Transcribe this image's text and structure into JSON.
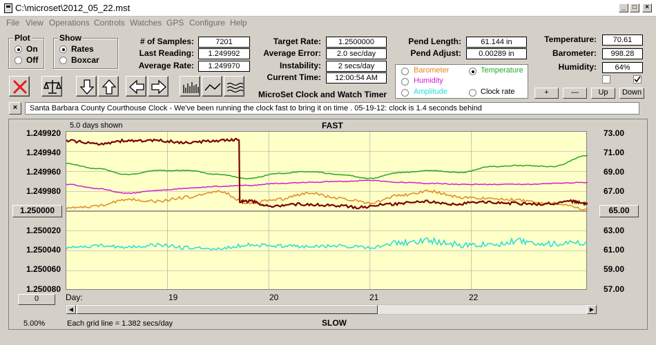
{
  "window": {
    "title": "C:\\microset\\2012_05_22.mst"
  },
  "menu": [
    "File",
    "View",
    "Operations",
    "Controls",
    "Watches",
    "GPS",
    "Configure",
    "Help"
  ],
  "plot_group": {
    "label": "Plot",
    "on": "On",
    "off": "Off"
  },
  "show_group": {
    "label": "Show",
    "rates": "Rates",
    "boxcar": "Boxcar"
  },
  "stats": {
    "samples_label": "# of Samples:",
    "samples": "7201",
    "last_reading_label": "Last Reading:",
    "last_reading": "1.249992",
    "average_rate_label": "Average Rate:",
    "average_rate": "1.249970",
    "target_rate_label": "Target Rate:",
    "target_rate": "1.2500000",
    "average_error_label": "Average Error:",
    "average_error": "2.0 sec/day",
    "instability_label": "Instability:",
    "instability": "2 secs/day",
    "current_time_label": "Current Time:",
    "current_time": "12:00:54 AM",
    "pend_length_label": "Pend Length:",
    "pend_length": "61.144 in",
    "pend_adjust_label": "Pend Adjust:",
    "pend_adjust": "0.00289 in",
    "temperature_label": "Temperature:",
    "temperature": "70.61",
    "barometer_label": "Barometer:",
    "barometer": "998.28",
    "humidity_label": "Humidity:",
    "humidity": "64%"
  },
  "app_name": "MicroSet Clock and Watch Timer",
  "right_axis_select": {
    "barometer": "Barometer",
    "temperature": "Temperature",
    "humidity": "Humidity",
    "amplitude": "Amplitude",
    "clock_rate": "Clock rate"
  },
  "axis_buttons": {
    "plus": "+",
    "minus": "—",
    "up": "Up",
    "down": "Down"
  },
  "notes": "Santa Barbara County Courthouse Clock - We've been running the clock fast to bring it on time .   05-19-12: clock is 1.4 seconds behind",
  "graph": {
    "days_shown": "5.0 days shown",
    "fast": "FAST",
    "slow": "SLOW",
    "grid_note": "Each grid line = 1.382 secs/day",
    "percent": "5.00%",
    "left_center_btn": "1.250000",
    "right_center_btn": "65.00",
    "zero_btn": "0",
    "day_label": "Day:"
  },
  "colors": {
    "rate": "#7a0000",
    "temperature": "#22aa22",
    "humidity": "#d01fd0",
    "barometer": "#e08820",
    "amplitude": "#22dddd",
    "plot_bg": "#ffffc8",
    "grid": "#a0a0a0"
  },
  "chart_data": {
    "type": "line",
    "title": "FAST",
    "xlabel": "Day:",
    "ylabel": "",
    "x_ticks": [
      "19",
      "20",
      "21",
      "22"
    ],
    "x_range": [
      18.0,
      23.15
    ],
    "y_ticks_left": [
      "1.249920",
      "1.249940",
      "1.249960",
      "1.249980",
      "1.250000",
      "1.250020",
      "1.250040",
      "1.250060",
      "1.250080"
    ],
    "y_ticks_right": [
      "73.00",
      "71.00",
      "69.00",
      "67.00",
      "65.00",
      "63.00",
      "61.00",
      "59.00",
      "57.00"
    ],
    "ylim_left": [
      1.25008,
      1.24992
    ],
    "ylim_right": [
      57,
      73
    ],
    "grid": true,
    "series": [
      {
        "name": "Rate",
        "axis": "left",
        "x": [
          18.0,
          18.3,
          18.6,
          18.9,
          19.2,
          19.5,
          19.7,
          19.82,
          20.0,
          20.3,
          20.6,
          20.9,
          21.2,
          21.5,
          21.8,
          22.1,
          22.4,
          22.7,
          23.0,
          23.15
        ],
        "y": [
          1.249929,
          1.249932,
          1.249929,
          1.249929,
          1.249931,
          1.249929,
          1.249928,
          1.24999,
          1.249995,
          1.249993,
          1.249994,
          1.249996,
          1.249993,
          1.24999,
          1.249993,
          1.249991,
          1.249992,
          1.249993,
          1.24999,
          1.249993
        ]
      },
      {
        "name": "Temperature",
        "axis": "right",
        "x": [
          18.0,
          18.3,
          18.6,
          18.9,
          19.2,
          19.5,
          19.8,
          20.1,
          20.4,
          20.7,
          21.0,
          21.3,
          21.6,
          21.9,
          22.2,
          22.5,
          22.8,
          23.15
        ],
        "y": [
          69.8,
          69.3,
          68.7,
          69.1,
          69.1,
          68.7,
          68.3,
          68.8,
          69.0,
          68.7,
          68.3,
          68.9,
          69.1,
          68.9,
          69.5,
          69.6,
          69.5,
          70.6
        ]
      },
      {
        "name": "Humidity",
        "axis": "right",
        "x": [
          18.0,
          18.3,
          18.6,
          18.9,
          19.2,
          19.5,
          19.8,
          20.1,
          20.4,
          20.7,
          21.0,
          21.3,
          21.6,
          21.9,
          22.2,
          22.5,
          22.8,
          23.15
        ],
        "y": [
          67.7,
          67.3,
          66.8,
          67.1,
          67.3,
          67.5,
          67.6,
          67.8,
          67.9,
          68.0,
          68.1,
          67.9,
          67.8,
          67.7,
          67.7,
          67.7,
          67.8,
          67.9
        ]
      },
      {
        "name": "Barometer",
        "axis": "right",
        "x": [
          18.0,
          18.3,
          18.6,
          18.9,
          19.2,
          19.5,
          19.8,
          20.1,
          20.4,
          20.7,
          21.0,
          21.3,
          21.6,
          21.9,
          22.2,
          22.5,
          22.8,
          23.15
        ],
        "y": [
          65.3,
          65.5,
          66.2,
          66.0,
          66.4,
          67.0,
          65.8,
          66.2,
          66.8,
          66.3,
          65.8,
          66.6,
          67.0,
          66.4,
          66.3,
          66.1,
          65.8,
          65.2
        ]
      },
      {
        "name": "Amplitude",
        "axis": "right",
        "x": [
          18.0,
          18.3,
          18.6,
          18.9,
          19.2,
          19.5,
          19.8,
          20.1,
          20.4,
          20.7,
          21.0,
          21.3,
          21.6,
          21.9,
          22.2,
          22.5,
          22.8,
          23.15
        ],
        "y": [
          61.3,
          61.5,
          61.4,
          61.6,
          61.3,
          61.2,
          61.6,
          61.5,
          61.4,
          61.5,
          61.3,
          61.8,
          62.0,
          61.6,
          61.7,
          62.0,
          61.7,
          61.8
        ]
      }
    ]
  }
}
